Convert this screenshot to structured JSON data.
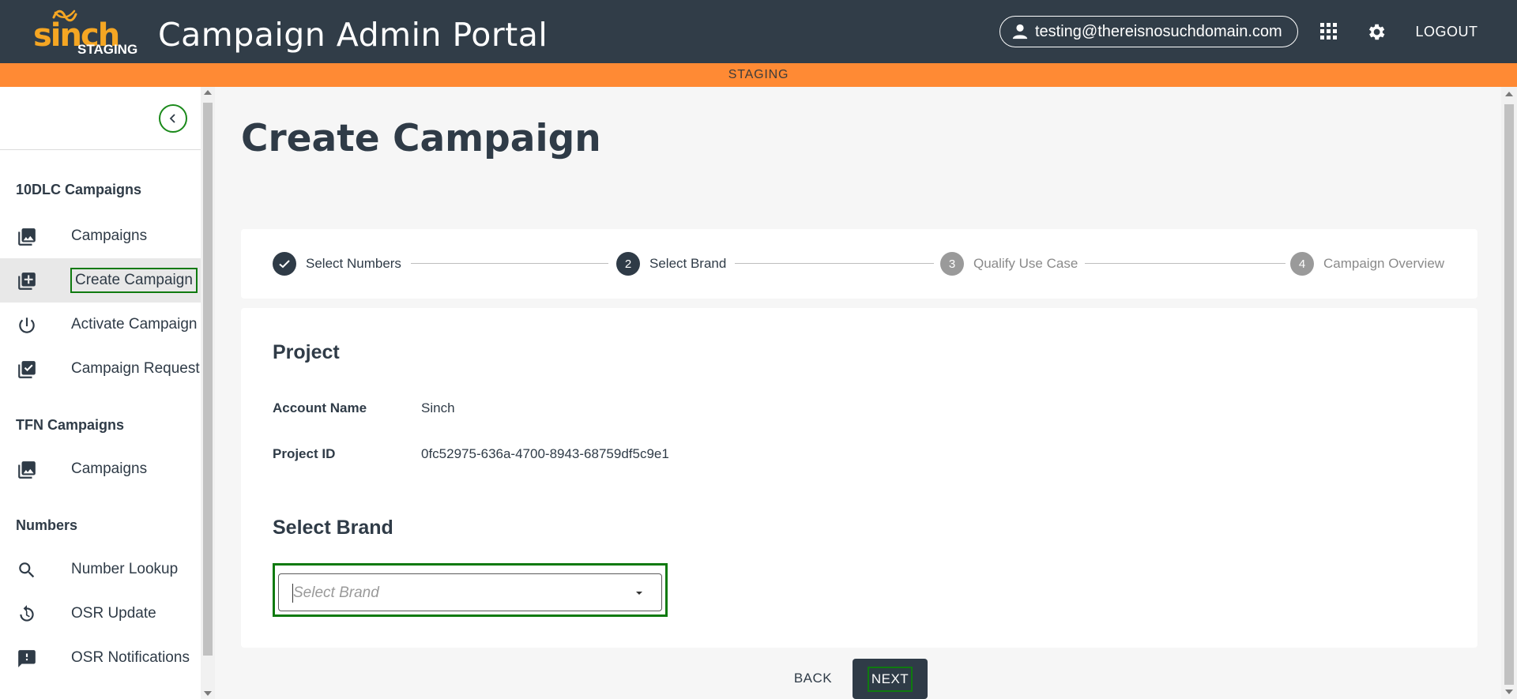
{
  "header": {
    "logo_text": "sinch",
    "logo_badge": "STAGING",
    "app_title": "Campaign Admin Portal",
    "user_email": "testing@thereisnosuchdomain.com",
    "logout_label": "LOGOUT",
    "icons": [
      "user-icon",
      "apps-grid-icon",
      "gear-icon"
    ]
  },
  "env_banner": "STAGING",
  "sidebar": {
    "sections": [
      {
        "title": "10DLC Campaigns",
        "items": [
          {
            "label": "Campaigns",
            "icon": "photo-library-icon"
          },
          {
            "label": "Create Campaign",
            "icon": "library-add-icon",
            "active": true
          },
          {
            "label": "Activate Campaign",
            "icon": "power-icon"
          },
          {
            "label": "Campaign Request",
            "icon": "library-check-icon"
          }
        ]
      },
      {
        "title": "TFN Campaigns",
        "items": [
          {
            "label": "Campaigns",
            "icon": "photo-library-icon"
          }
        ]
      },
      {
        "title": "Numbers",
        "items": [
          {
            "label": "Number Lookup",
            "icon": "search-icon"
          },
          {
            "label": "OSR Update",
            "icon": "history-icon"
          },
          {
            "label": "OSR Notifications",
            "icon": "feedback-icon"
          }
        ]
      }
    ]
  },
  "main": {
    "page_title": "Create Campaign",
    "steps": [
      {
        "number": "1",
        "label": "Select Numbers",
        "state": "completed"
      },
      {
        "number": "2",
        "label": "Select Brand",
        "state": "active"
      },
      {
        "number": "3",
        "label": "Qualify Use Case",
        "state": "pending"
      },
      {
        "number": "4",
        "label": "Campaign Overview",
        "state": "pending"
      }
    ],
    "project": {
      "title": "Project",
      "account_name_label": "Account Name",
      "account_name_value": "Sinch",
      "project_id_label": "Project ID",
      "project_id_value": "0fc52975-636a-4700-8943-68759df5c9e1"
    },
    "select_brand": {
      "title": "Select Brand",
      "placeholder": "Select Brand",
      "value": ""
    },
    "actions": {
      "back_label": "BACK",
      "next_label": "NEXT"
    }
  },
  "colors": {
    "header_bg": "#313d48",
    "env_banner_bg": "#ff8a34",
    "logo_accent": "#f5a623",
    "focus_outline": "#0f7a0f",
    "primary_dark": "#2f3b47"
  }
}
